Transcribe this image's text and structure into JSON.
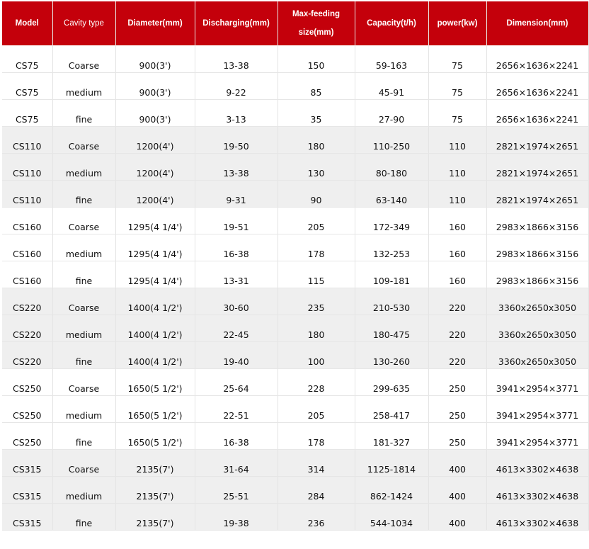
{
  "table": {
    "headers": [
      "Model",
      "Cavity type",
      "Diameter(mm)",
      "Discharging(mm)",
      [
        "Max-feeding",
        "size(mm)"
      ],
      "Capacity(t/h)",
      "power(kw)",
      "Dimension(mm)"
    ],
    "rows": [
      [
        "CS75",
        "Coarse",
        "900(3')",
        "13-38",
        "150",
        "59-163",
        "75",
        "2656×1636×2241"
      ],
      [
        "CS75",
        "medium",
        "900(3')",
        "9-22",
        "85",
        "45-91",
        "75",
        "2656×1636×2241"
      ],
      [
        "CS75",
        "fine",
        "900(3')",
        "3-13",
        "35",
        "27-90",
        "75",
        "2656×1636×2241"
      ],
      [
        "CS110",
        "Coarse",
        "1200(4')",
        "19-50",
        "180",
        "110-250",
        "110",
        "2821×1974×2651"
      ],
      [
        "CS110",
        "medium",
        "1200(4')",
        "13-38",
        "130",
        "80-180",
        "110",
        "2821×1974×2651"
      ],
      [
        "CS110",
        "fine",
        "1200(4')",
        "9-31",
        "90",
        "63-140",
        "110",
        "2821×1974×2651"
      ],
      [
        "CS160",
        "Coarse",
        "1295(4 1/4')",
        "19-51",
        "205",
        "172-349",
        "160",
        "2983×1866×3156"
      ],
      [
        "CS160",
        "medium",
        "1295(4 1/4')",
        "16-38",
        "178",
        "132-253",
        "160",
        "2983×1866×3156"
      ],
      [
        "CS160",
        "fine",
        "1295(4 1/4')",
        "13-31",
        "115",
        "109-181",
        "160",
        "2983×1866×3156"
      ],
      [
        "CS220",
        "Coarse",
        "1400(4 1/2')",
        "30-60",
        "235",
        "210-530",
        "220",
        "3360x2650x3050"
      ],
      [
        "CS220",
        "medium",
        "1400(4 1/2')",
        "22-45",
        "180",
        "180-475",
        "220",
        "3360x2650x3050"
      ],
      [
        "CS220",
        "fine",
        "1400(4 1/2')",
        "19-40",
        "100",
        "130-260",
        "220",
        "3360x2650x3050"
      ],
      [
        "CS250",
        "Coarse",
        "1650(5 1/2')",
        "25-64",
        "228",
        "299-635",
        "250",
        "3941×2954×3771"
      ],
      [
        "CS250",
        "medium",
        "1650(5 1/2')",
        "22-51",
        "205",
        "258-417",
        "250",
        "3941×2954×3771"
      ],
      [
        "CS250",
        "fine",
        "1650(5 1/2')",
        "16-38",
        "178",
        "181-327",
        "250",
        "3941×2954×3771"
      ],
      [
        "CS315",
        "Coarse",
        "2135(7')",
        "31-64",
        "314",
        "1125-1814",
        "400",
        "4613×3302×4638"
      ],
      [
        "CS315",
        "medium",
        "2135(7')",
        "25-51",
        "284",
        "862-1424",
        "400",
        "4613×3302×4638"
      ],
      [
        "CS315",
        "fine",
        "2135(7')",
        "19-38",
        "236",
        "544-1034",
        "400",
        "4613×3302×4638"
      ]
    ],
    "row_shading": [
      "white",
      "white",
      "white",
      "grey",
      "grey",
      "grey",
      "white",
      "white",
      "white",
      "grey",
      "grey",
      "grey",
      "white",
      "white",
      "white",
      "grey",
      "grey",
      "grey"
    ],
    "colors": {
      "header_bg": "#c4000b",
      "header_text": "#ffffff",
      "shaded_row": "#efefef"
    }
  }
}
